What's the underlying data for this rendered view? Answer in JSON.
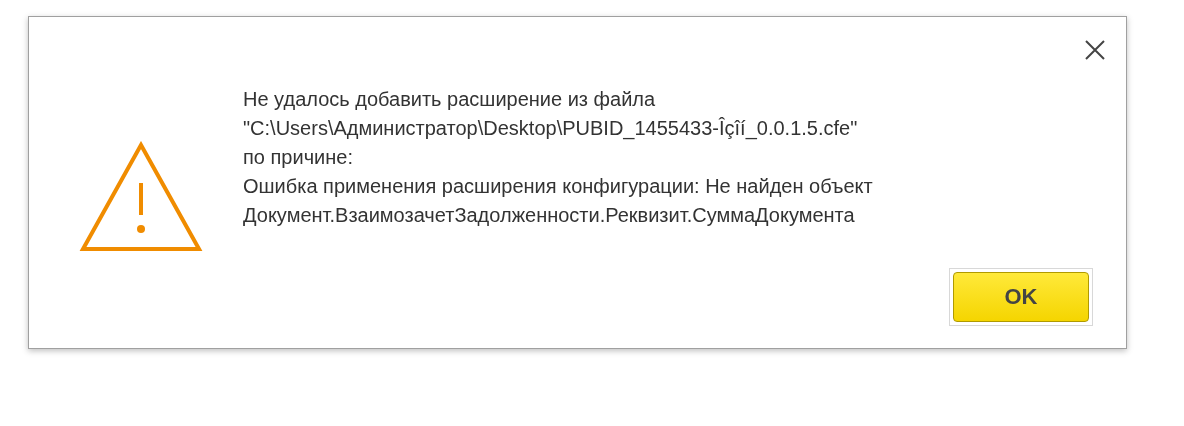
{
  "message_lines": [
    "Не удалось добавить расширение из файла",
    "\"C:\\Users\\Администратор\\Desktop\\PUBID_1455433-Îçîí_0.0.1.5.cfe\"",
    "по причине:",
    "Ошибка применения расширения конфигурации: Не найден объект",
    "Документ.ВзаимозачетЗадолженности.Реквизит.СуммаДокумента"
  ],
  "buttons": [
    {
      "label": "OK",
      "selected": true
    }
  ]
}
